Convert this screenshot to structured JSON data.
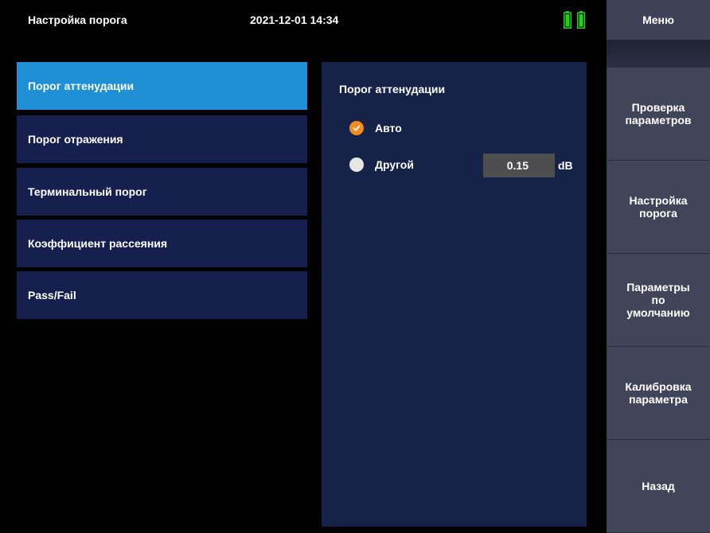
{
  "header": {
    "title": "Настройка порога",
    "datetime": "2021-12-01 14:34",
    "battery_icon": "battery-icon",
    "battery_color": "#23d21b"
  },
  "menu": {
    "title": "Меню",
    "buttons": [
      {
        "label": "Проверка\nпараметров"
      },
      {
        "label": "Настройка\nпорога"
      },
      {
        "label": "Параметры\nпо\nумолчанию"
      },
      {
        "label": "Калибровка\nпараметра"
      },
      {
        "label": "Назад"
      }
    ]
  },
  "nav": {
    "items": [
      {
        "label": "Порог аттенудации",
        "active": true
      },
      {
        "label": "Порог отражения"
      },
      {
        "label": "Терминальный порог"
      },
      {
        "label": "Коэффициент рассеяния"
      },
      {
        "label": "Pass/Fail"
      }
    ]
  },
  "panel": {
    "title": "Порог аттенудации",
    "options": [
      {
        "label": "Авто",
        "selected": true,
        "icon": "check-icon"
      },
      {
        "label": "Другой",
        "selected": false
      }
    ],
    "value": "0.15",
    "unit": "dB"
  },
  "colors": {
    "accent": "#1f8fd6",
    "radio_checked": "#f28c1e",
    "panel_bg": "#162349",
    "nav_bg": "#16204f",
    "sidebar_bg": "#424459"
  }
}
